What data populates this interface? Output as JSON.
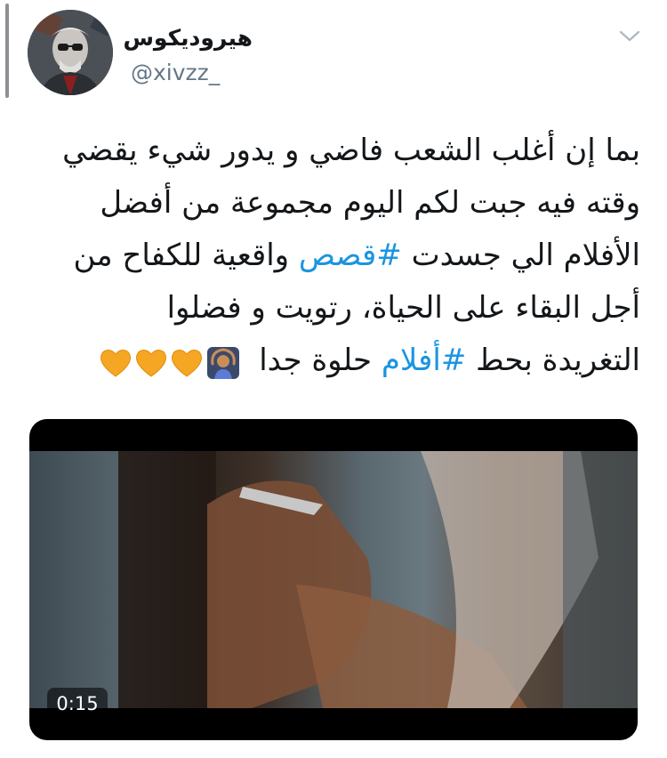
{
  "tweet": {
    "display_name": "هيروديكوس",
    "handle": "@xivzz_",
    "text_lines": [
      {
        "text": "بما إن أغلب الشعب فاضي و يدور شيء يقضي"
      },
      {
        "text": "وقته فيه جبت لكم اليوم مجموعة من أفضل"
      },
      {
        "before": "الأفلام الي جسدت ",
        "hashtag": "#قصص",
        "after": " واقعية للكفاح من"
      },
      {
        "text": "أجل البقاء على الحياة، رتويت و فضلوا"
      },
      {
        "before": "التغريدة بحط ",
        "hashtag": "#أفلام",
        "after": " حلوة جدا"
      }
    ],
    "emojis": [
      "person-gesturing-ok-icon",
      "orange-heart-icon",
      "orange-heart-icon",
      "orange-heart-icon"
    ]
  },
  "video": {
    "duration": "0:15"
  },
  "colors": {
    "text": "#14171a",
    "secondary": "#657786",
    "hashtag": "#1b95e0",
    "heart": "#f5a623",
    "scrollbar": "#8e8e93"
  }
}
